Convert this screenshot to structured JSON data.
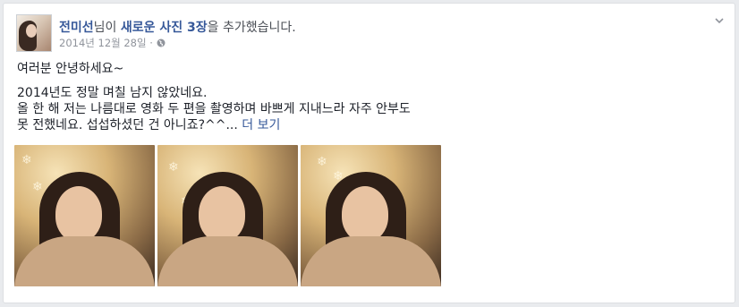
{
  "post": {
    "author": "전미선",
    "action_prefix": "님이 ",
    "action_highlight": "새로운 사진 3장",
    "action_suffix": "을 추가했습니다.",
    "date": "2014년 12월 28일 ·",
    "privacy_icon": "globe-icon",
    "menu_icon": "chevron-down-icon",
    "lines": [
      "여러분 안녕하세요~",
      "2014년도 정말 며칠 남지 않았네요.",
      "올 한 해 저는 나름대로 영화 두 편을 촬영하며 바쁘게 지내느라 자주 안부도",
      "못 전했네요. 섭섭하셨던 건 아니죠?^^..."
    ],
    "more_link": "더 보기"
  },
  "colors": {
    "link": "#365899",
    "text": "#1d2129",
    "meta": "#90949c",
    "page_bg": "#e9ebee"
  }
}
